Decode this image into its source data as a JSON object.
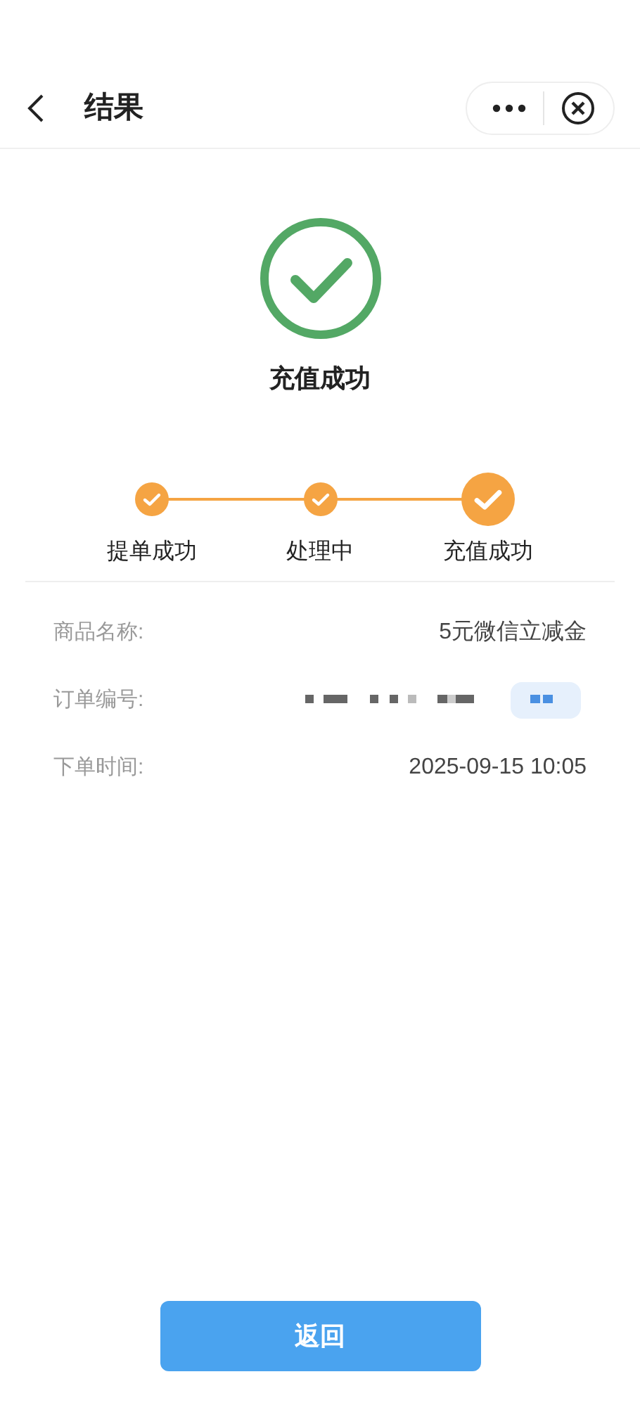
{
  "nav": {
    "title": "结果"
  },
  "result": {
    "kind": "success",
    "title": "充值成功"
  },
  "steps": [
    {
      "label": "提单成功",
      "done": true,
      "current": false
    },
    {
      "label": "处理中",
      "done": true,
      "current": false
    },
    {
      "label": "充值成功",
      "done": true,
      "current": true
    }
  ],
  "details": [
    {
      "kind": "text",
      "label": "商品名称:",
      "value": "5元微信立减金"
    },
    {
      "kind": "redacted",
      "label": "订单编号:"
    },
    {
      "kind": "text",
      "label": "下单时间:",
      "value": "2025-09-15 10:05"
    }
  ],
  "button": {
    "label": "返回"
  }
}
